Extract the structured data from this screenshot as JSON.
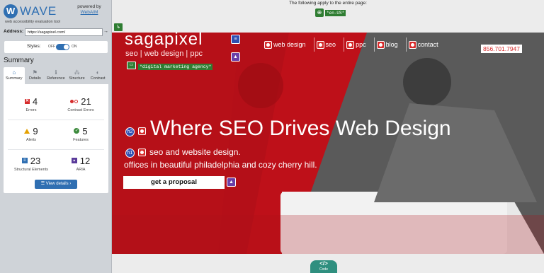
{
  "wave": {
    "logo_mark": "W",
    "logo_name": "WAVE",
    "tagline": "web accessibility evaluation tool",
    "powered_by": "powered by",
    "webaim_link": "WebAIM",
    "address_label": "Address:",
    "address_value": "https://sagapixel.com/",
    "address_go": "→",
    "styles_label": "Styles:",
    "styles_off": "OFF",
    "styles_on": "ON",
    "summary_title": "Summary",
    "tabs": [
      {
        "label": "Summary",
        "icon": "home-icon",
        "glyph": "⌂"
      },
      {
        "label": "Details",
        "icon": "flag-icon",
        "glyph": "⚑"
      },
      {
        "label": "Reference",
        "icon": "info-icon",
        "glyph": "ℹ"
      },
      {
        "label": "Structure",
        "icon": "structure-icon",
        "glyph": "⁂"
      },
      {
        "label": "Contrast",
        "icon": "contrast-icon",
        "glyph": "◐"
      }
    ],
    "stats": {
      "errors": {
        "count": "4",
        "label": "Errors"
      },
      "contrast_errors": {
        "count": "21",
        "label": "Contrast Errors"
      },
      "alerts": {
        "count": "9",
        "label": "Alerts"
      },
      "features": {
        "count": "5",
        "label": "Features"
      },
      "structural": {
        "count": "23",
        "label": "Structural Elements"
      },
      "aria": {
        "count": "12",
        "label": "ARIA"
      }
    },
    "view_details": "☰ View details ›"
  },
  "page_header": {
    "applies_text": "The following apply to the entire page:",
    "lang_badge": "*en-US*"
  },
  "site": {
    "logo": "sagapixel",
    "tagline": "seo | web design | ppc",
    "nav": [
      "web design",
      "seo",
      "ppc",
      "blog",
      "contact"
    ],
    "phone": "856.701.7947",
    "alt_text": "*digital marketing agency*",
    "headline": "Where SEO Drives Web Design",
    "sub_line_1": "seo and website design.",
    "sub_line_2": "offices in beautiful philadelphia and cozy cherry hill.",
    "cta": "get a proposal",
    "icon_h2": "h2",
    "icon_h1": "h1"
  },
  "code_tab": {
    "symbol": "</>",
    "label": "Code"
  },
  "colors": {
    "wave_blue": "#2f6fb2",
    "error_red": "#d62b2b",
    "feature_green": "#2f7d32",
    "aria_purple": "#6a3ea8",
    "hero_red": "#c8121b"
  }
}
